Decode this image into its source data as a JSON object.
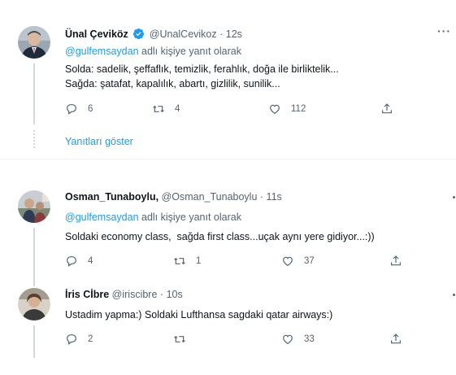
{
  "tweets": [
    {
      "name": "Ünal Çeviköz",
      "verified": true,
      "handle": "@UnalCevikoz",
      "separator": "·",
      "time": "12s",
      "reply_prefix": "@gulfemsaydan",
      "reply_suffix": " adlı kişiye yanıt olarak",
      "lines": [
        "Solda: sadelik, şeffaflık, temizlik, ferahlık, doğa ile birliktelik...",
        "Sağda: şatafat, kapalılık, abartı, gizlilik, sunilik..."
      ],
      "replies": "6",
      "retweets": "4",
      "likes": "112",
      "more_label": "···",
      "show_replies": "Yanıtları göster"
    },
    {
      "name": "Osman_Tunaboylu,",
      "handle": "@Osman_Tunaboylu",
      "separator": "·",
      "time": "11s",
      "reply_prefix": "@gulfemsaydan",
      "reply_suffix": " adlı kişiye yanıt olarak",
      "lines": [
        "Soldaki economy class,  sağda first class...uçak aynı yere gidiyor...:))"
      ],
      "replies": "4",
      "retweets": "1",
      "likes": "37"
    },
    {
      "name": "İris Cİbre",
      "handle": "@iriscibre",
      "separator": "·",
      "time": "10s",
      "lines": [
        "Ustadim yapma:) Soldaki Lufthansa sagdaki qatar airways:)"
      ],
      "replies": "2",
      "retweets": "",
      "likes": "33"
    }
  ],
  "colors": {
    "accent": "#1d9bf0",
    "muted": "#536471",
    "text": "#0f1419",
    "line": "#cfd9de"
  },
  "icons": [
    "verified-badge-icon",
    "reply-icon",
    "retweet-icon",
    "like-icon",
    "share-icon",
    "more-icon"
  ]
}
